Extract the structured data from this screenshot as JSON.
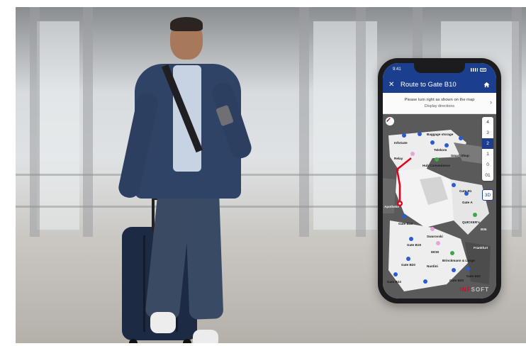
{
  "phone": {
    "status": {
      "time": "9:41"
    },
    "app_bar": {
      "title": "Route to Gate B10"
    },
    "directions": {
      "instruction": "Please turn right as shown on the map",
      "link": "Display directions"
    },
    "floor_selector": {
      "floors": [
        "4",
        "3",
        "2",
        "1",
        "0",
        "01"
      ],
      "active_floor": "2",
      "view_toggle": "3D"
    },
    "map_labels": [
      "Baggage storage",
      "InfoGate",
      "Telekom",
      "Relay",
      "Smart Shop",
      "Gate B1",
      "Hub Convenience",
      "Gate A",
      "Gate B13",
      "Swarovski",
      "Gate B19",
      "MCM",
      "Brinckmann & Lange",
      "Gate B20",
      "Nardini",
      "Gate B22",
      "Gate B33",
      "Gate B32",
      "QUICKER's",
      "Frankfurt",
      "B05",
      "Apotheke"
    ],
    "brand": {
      "prefix": "INF",
      "suffix": "SOFT"
    }
  },
  "colors": {
    "app_bar": "#1b3f8e",
    "route": "#e2001a",
    "map_bg": "#5a5a5a",
    "walkway": "#f1f1f1",
    "poi_blue": "#2a5bd7",
    "poi_green": "#3aa84a",
    "poi_pink": "#e7a3d9"
  }
}
